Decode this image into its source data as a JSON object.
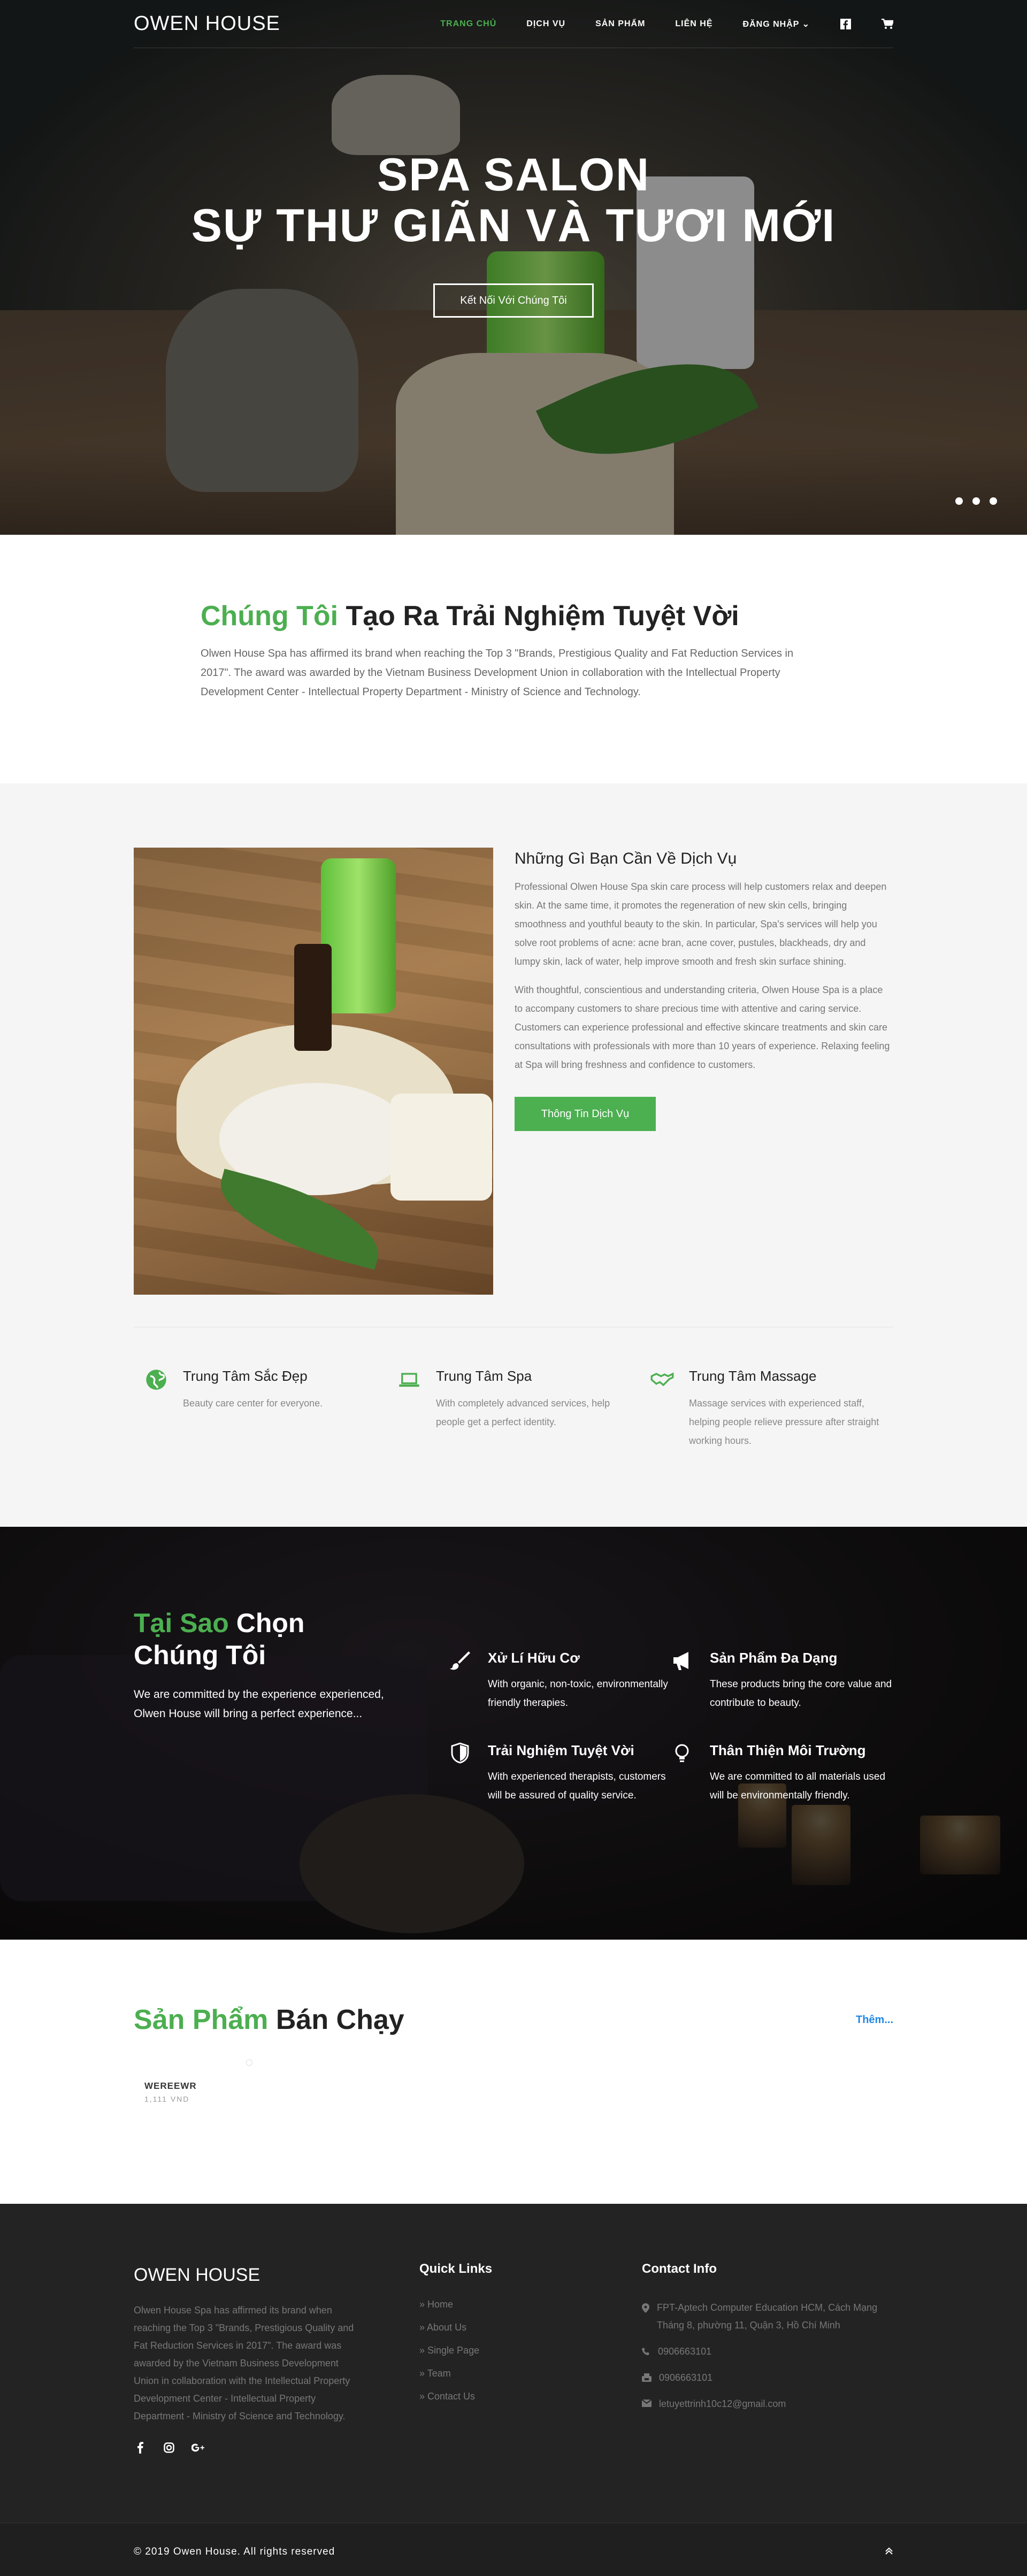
{
  "nav": {
    "logo": "OWEN HOUSE",
    "items": [
      "TRANG CHỦ",
      "DỊCH VỤ",
      "SẢN PHẨM",
      "LIÊN HỆ",
      "ĐĂNG NHẬP"
    ]
  },
  "hero": {
    "title_line1": "SPA SALON",
    "title_line2": "SỰ THƯ GIÃN VÀ TƯƠI MỚI",
    "button": "Kết Nối Với Chúng Tôi"
  },
  "intro": {
    "title_green": "Chúng Tôi",
    "title_rest": " Tạo Ra Trải Nghiệm Tuyệt Vời",
    "text": "Olwen House Spa has affirmed its brand when reaching the Top 3 \"Brands, Prestigious Quality and Fat Reduction Services in 2017\". The award was awarded by the Vietnam Business Development Union in collaboration with the Intellectual Property Development Center - Intellectual Property Department - Ministry of Science and Technology."
  },
  "services": {
    "title": "Những Gì Bạn Cần Về Dịch Vụ",
    "p1": "Professional Olwen House Spa skin care process will help customers relax and deepen skin. At the same time, it promotes the regeneration of new skin cells, bringing smoothness and youthful beauty to the skin. In particular, Spa's services will help you solve root problems of acne: acne bran, acne cover, pustules, blackheads, dry and lumpy skin, lack of water, help improve smooth and fresh skin surface shining.",
    "p2": "With thoughtful, conscientious and understanding criteria, Olwen House Spa is a place to accompany customers to share precious time with attentive and caring service. Customers can experience professional and effective skincare treatments and skin care consultations with professionals with more than 10 years of experience. Relaxing feeling at Spa will bring freshness and confidence to customers.",
    "button": "Thông Tin Dịch Vụ",
    "features": [
      {
        "title": "Trung Tâm Sắc Đẹp",
        "text": "Beauty care center for everyone."
      },
      {
        "title": "Trung Tâm Spa",
        "text": "With completely advanced services, help people get a perfect identity."
      },
      {
        "title": "Trung Tâm Massage",
        "text": "Massage services with experienced staff, helping people relieve pressure after straight working hours."
      }
    ]
  },
  "why": {
    "title_green": "Tại Sao",
    "title_rest": " Chọn Chúng Tôi",
    "text": "We are committed by the experience experienced, Olwen House will bring a perfect experience...",
    "items": [
      {
        "title": "Xử Lí Hữu Cơ",
        "text": "With organic, non-toxic, environmentally friendly therapies."
      },
      {
        "title": "Sản Phẩm Đa Dạng",
        "text": "These products bring the core value and contribute to beauty."
      },
      {
        "title": "Trải Nghiệm Tuyệt Vời",
        "text": "With experienced therapists, customers will be assured of quality service."
      },
      {
        "title": "Thân Thiện Môi Trường",
        "text": "We are committed to all materials used will be environmentally friendly."
      }
    ]
  },
  "products": {
    "title_green": "Sản Phẩm",
    "title_rest": " Bán Chạy",
    "more": "Thêm...",
    "items": [
      {
        "name": "WEREEWR",
        "price": "1,111 VND"
      }
    ]
  },
  "footer": {
    "logo": "OWEN HOUSE",
    "about": "Olwen House Spa has affirmed its brand when reaching the Top 3 \"Brands, Prestigious Quality and Fat Reduction Services in 2017\". The award was awarded by the Vietnam Business Development Union in collaboration with the Intellectual Property Development Center - Intellectual Property Department - Ministry of Science and Technology.",
    "links_title": "Quick Links",
    "links": [
      "Home",
      "About Us",
      "Single Page",
      "Team",
      "Contact Us"
    ],
    "contact_title": "Contact Info",
    "address": "FPT-Aptech Computer Education HCM, Cách Mạng Tháng 8, phường 11, Quận 3, Hồ Chí Minh",
    "phone": "0906663101",
    "fax": "0906663101",
    "email": "letuyettrinh10c12@gmail.com",
    "copyright": "© 2019 Owen House. All rights reserved"
  }
}
